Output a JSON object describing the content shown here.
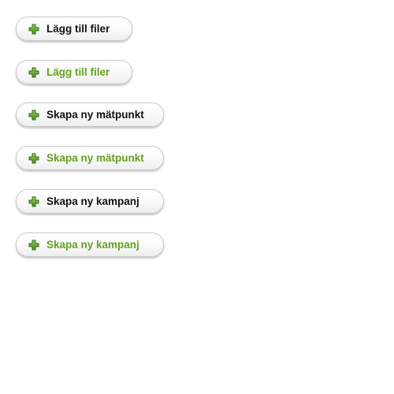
{
  "colors": {
    "normal_text": "#111111",
    "hover_text": "#63a11f",
    "plus_icon": "#5a9a1f",
    "plus_icon_dark": "#2f6d10"
  },
  "icons": {
    "plus": "plus-icon"
  },
  "buttons": [
    {
      "label": "Lägg till filer",
      "state": "normal"
    },
    {
      "label": "Lägg till filer",
      "state": "hover"
    },
    {
      "label": "Skapa ny mätpunkt",
      "state": "normal"
    },
    {
      "label": "Skapa ny mätpunkt",
      "state": "hover"
    },
    {
      "label": "Skapa ny kampanj",
      "state": "normal"
    },
    {
      "label": "Skapa ny kampanj",
      "state": "hover"
    }
  ]
}
